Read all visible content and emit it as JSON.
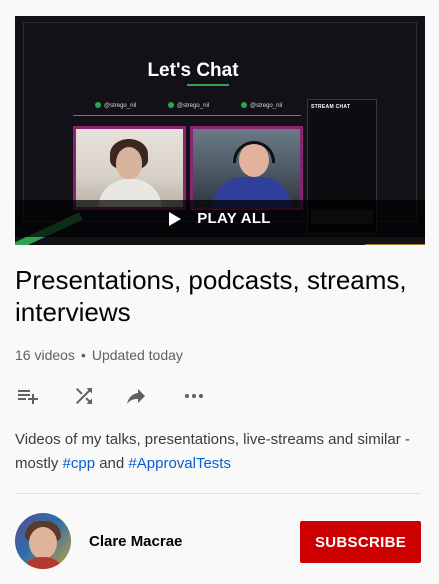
{
  "thumbnail": {
    "overlay_title": "Let's Chat",
    "socials": [
      "@strego_nil",
      "@strego_nil",
      "@strego_nil"
    ],
    "chat_title": "STREAM CHAT",
    "play_all_label": "PLAY ALL"
  },
  "playlist": {
    "title": "Presentations, podcasts, streams, interviews",
    "video_count": "16 videos",
    "separator": "•",
    "updated": "Updated today",
    "description_prefix": "Videos of my talks, presentations, live-streams and similar - mostly ",
    "tag1": "#cpp",
    "description_middle": " and ",
    "tag2": "#ApprovalTests"
  },
  "actions": [
    {
      "icon": "add-to-queue-icon"
    },
    {
      "icon": "shuffle-icon"
    },
    {
      "icon": "share-icon"
    },
    {
      "icon": "more-icon"
    }
  ],
  "channel": {
    "name": "Clare Macrae",
    "subscribe_label": "SUBSCRIBE"
  },
  "colors": {
    "subscribe": "#cc0000",
    "hashtag": "#065fd4",
    "accent_green": "#2ea352"
  }
}
